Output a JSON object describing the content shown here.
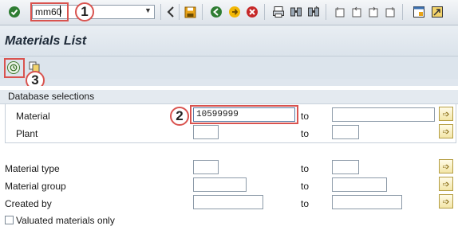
{
  "toolbar": {
    "command_value": "mm60",
    "icons": [
      "enter-icon",
      "back-icon",
      "save-icon",
      "back-green-icon",
      "exit-icon",
      "cancel-icon",
      "print-icon",
      "find-icon",
      "find-next-icon",
      "first-page-icon",
      "prev-page-icon",
      "next-page-icon",
      "last-page-icon",
      "new-session-icon",
      "shortcut-icon"
    ]
  },
  "callouts": {
    "c1": "1",
    "c2": "2",
    "c3": "3"
  },
  "title": "Materials List",
  "database_selections": {
    "heading": "Database selections",
    "material": {
      "label": "Material",
      "from": "10599999",
      "to_label": "to",
      "to": ""
    },
    "plant": {
      "label": "Plant",
      "from": "",
      "to_label": "to",
      "to": ""
    }
  },
  "other": {
    "material_type": {
      "label": "Material type",
      "to_label": "to"
    },
    "material_group": {
      "label": "Material group",
      "to_label": "to"
    },
    "created_by": {
      "label": "Created by",
      "to_label": "to"
    }
  },
  "checkbox": {
    "label": "Valuated materials only",
    "checked": false
  },
  "colors": {
    "highlight": "#d9534f",
    "accent_yellow": "#f3e6a8",
    "link_green": "#3f7a2e"
  }
}
